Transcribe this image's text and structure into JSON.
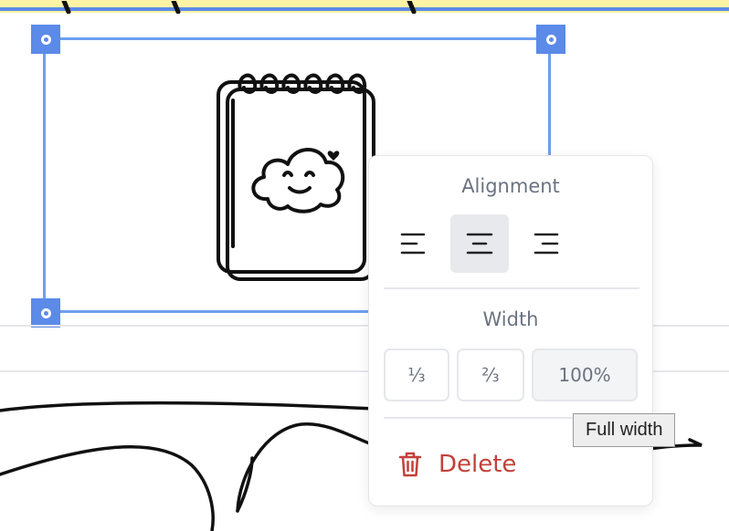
{
  "popover": {
    "alignment_title": "Alignment",
    "alignment_options": [
      {
        "icon": "align-left-icon",
        "selected": false
      },
      {
        "icon": "align-center-icon",
        "selected": true
      },
      {
        "icon": "align-right-icon",
        "selected": false
      }
    ],
    "width_title": "Width",
    "width_options": [
      "⅓",
      "⅔",
      "100%"
    ],
    "delete_label": "Delete"
  },
  "tooltip": "Full width",
  "colors": {
    "selection": "#6e9ff0",
    "handle": "#5b8ae8",
    "delete": "#c2413a",
    "highlight": "#fff3a6"
  }
}
